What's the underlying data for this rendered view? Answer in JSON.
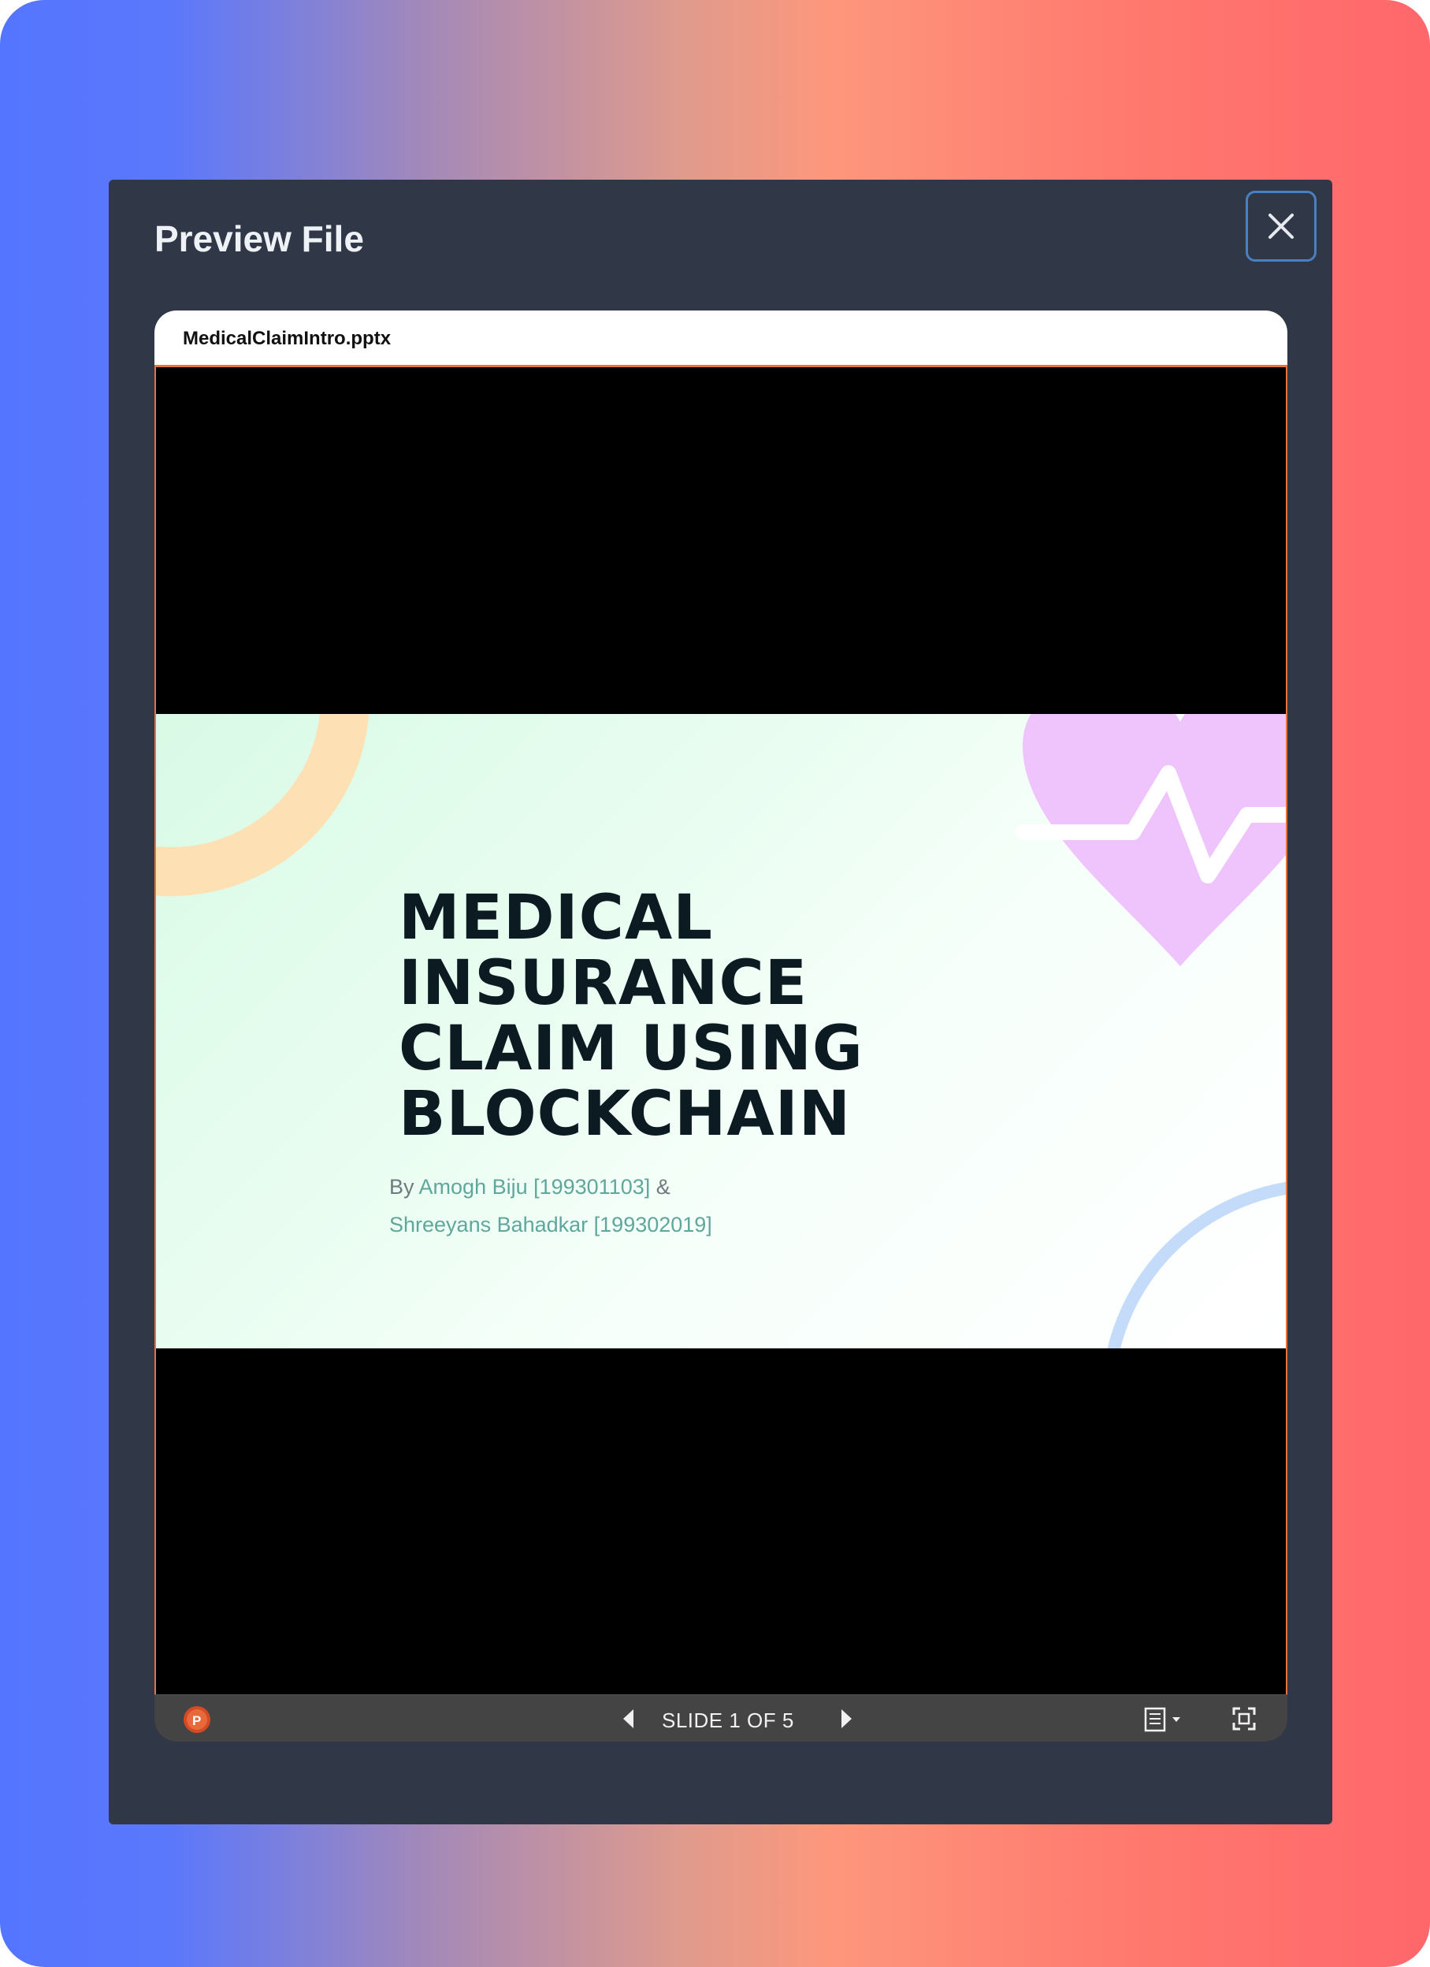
{
  "modal": {
    "title": "Preview File",
    "close_icon": "close-icon"
  },
  "viewer": {
    "file_name": "MedicalClaimIntro.pptx",
    "slide": {
      "title_lines": [
        "MEDICAL",
        "INSURANCE",
        "CLAIM USING",
        "BLOCKCHAIN"
      ],
      "by_prefix": "By ",
      "author1": "Amogh Biju [199301103]",
      "and": " &",
      "author2": "Shreeyans Bahadkar [199302019]"
    },
    "toolbar": {
      "app_icon": "powerpoint-icon",
      "app_letter": "P",
      "prev_icon": "triangle-left-icon",
      "counter": "SLIDE 1 OF 5",
      "next_icon": "triangle-right-icon",
      "notes_icon": "notes-icon",
      "fullscreen_icon": "fullscreen-icon"
    }
  },
  "colors": {
    "modal_bg": "#303848",
    "accent_border": "#e3733f",
    "close_border": "#4a7fc0",
    "author_text": "#5fa79c",
    "toolbar_bg": "#444444"
  }
}
